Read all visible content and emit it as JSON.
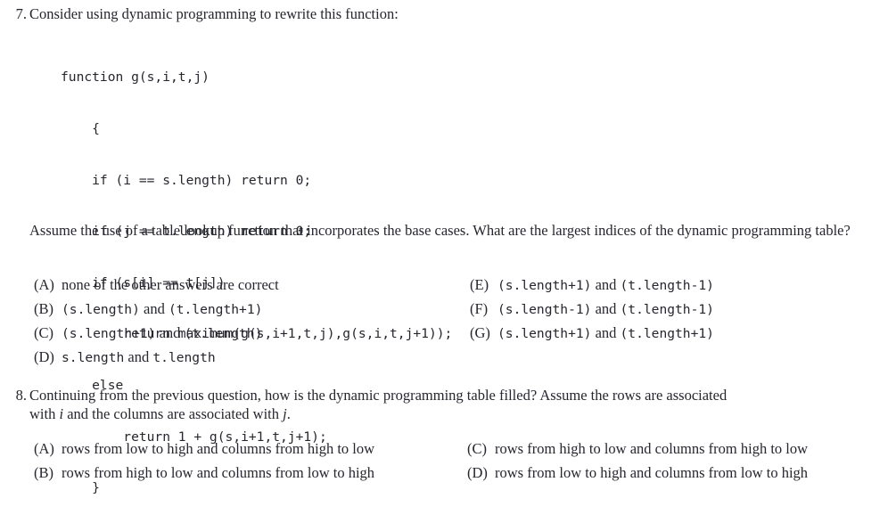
{
  "document": {
    "kind": "exam-question-sheet",
    "text_color": "#26262e",
    "background_color": "#ffffff"
  },
  "questions": [
    {
      "number": "7.",
      "prompt": "Consider using dynamic programming to rewrite this function:",
      "code": [
        "function g(s,i,t,j)",
        "    {",
        "    if (i == s.length) return 0;",
        "    if (j == t.length) return 0;",
        "    if (s[i] == t[j])",
        "        return maximum(g(s,i+1,t,j),g(s,i,t,j+1));",
        "    else",
        "        return 1 + g(s,i+1,t,j+1);",
        "    }"
      ],
      "paragraph": "Assume the use of a table lookup function that incorporates the base cases. What are the largest indices of the dynamic programming table?",
      "choices": [
        {
          "label": "(A)",
          "parts": [
            {
              "type": "roman",
              "text": "none of the other answers are correct"
            }
          ]
        },
        {
          "label": "(B)",
          "parts": [
            {
              "type": "mono",
              "text": "(s.length)"
            },
            {
              "type": "roman",
              "text": " and "
            },
            {
              "type": "mono",
              "text": "(t.length+1)"
            }
          ]
        },
        {
          "label": "(C)",
          "parts": [
            {
              "type": "mono",
              "text": "(s.length+1)"
            },
            {
              "type": "roman",
              "text": " and "
            },
            {
              "type": "mono",
              "text": "(t.length)"
            }
          ]
        },
        {
          "label": "(D)",
          "parts": [
            {
              "type": "mono",
              "text": "s.length"
            },
            {
              "type": "roman",
              "text": " and "
            },
            {
              "type": "mono",
              "text": "t.length"
            }
          ]
        },
        {
          "label": "(E)",
          "parts": [
            {
              "type": "mono",
              "text": "(s.length+1)"
            },
            {
              "type": "roman",
              "text": " and "
            },
            {
              "type": "mono",
              "text": "(t.length-1)"
            }
          ]
        },
        {
          "label": "(F)",
          "parts": [
            {
              "type": "mono",
              "text": "(s.length-1)"
            },
            {
              "type": "roman",
              "text": " and "
            },
            {
              "type": "mono",
              "text": "(t.length-1)"
            }
          ]
        },
        {
          "label": "(G)",
          "parts": [
            {
              "type": "mono",
              "text": "(s.length+1)"
            },
            {
              "type": "roman",
              "text": " and "
            },
            {
              "type": "mono",
              "text": "(t.length+1)"
            }
          ]
        }
      ]
    },
    {
      "number": "8.",
      "prompt_line1": "Continuing from the previous question, how is the dynamic programming table filled? Assume the rows are associated",
      "prompt_line2_a": "with ",
      "prompt_line2_i": "i",
      "prompt_line2_b": " and the columns are associated with ",
      "prompt_line2_j": "j",
      "prompt_line2_c": ".",
      "choices": [
        {
          "label": "(A)",
          "text": "rows from low to high and columns from high to low"
        },
        {
          "label": "(B)",
          "text": "rows from high to low and columns from low to high"
        },
        {
          "label": "(C)",
          "text": "rows from high to low and columns from high to low"
        },
        {
          "label": "(D)",
          "text": "rows from low to high and columns from low to high"
        }
      ]
    }
  ]
}
